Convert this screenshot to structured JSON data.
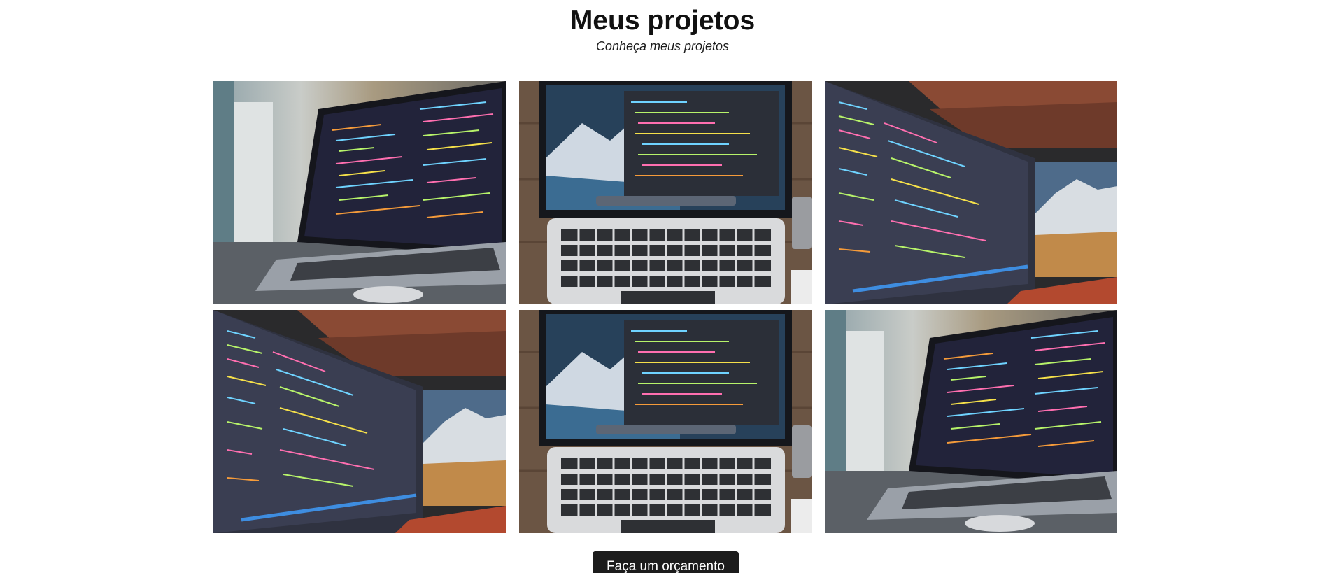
{
  "header": {
    "title": "Meus projetos",
    "subtitle": "Conheça meus projetos"
  },
  "projects": [
    {
      "image": "laptop-side-code-photo"
    },
    {
      "image": "laptop-top-down-photo"
    },
    {
      "image": "laptop-dual-screen-photo"
    },
    {
      "image": "laptop-dual-screen-photo"
    },
    {
      "image": "laptop-top-down-photo"
    },
    {
      "image": "laptop-side-code-photo"
    }
  ],
  "cta": {
    "label": "Faça um orçamento"
  },
  "colors": {
    "background": "#ffffff",
    "button": "#1c1c1c",
    "button_text": "#ffffff"
  }
}
